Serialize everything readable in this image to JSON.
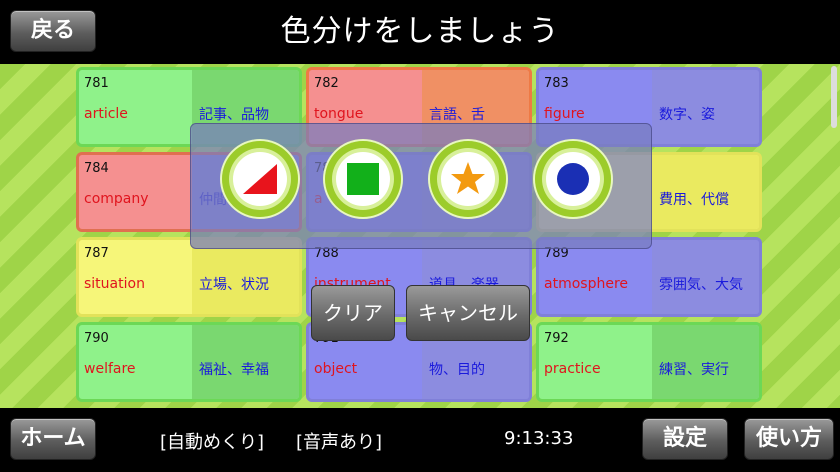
{
  "header": {
    "title": "色分けをしましょう",
    "back_label": "戻る"
  },
  "cards": [
    {
      "num": "781",
      "en": "article",
      "ja": "記事、品物",
      "color": "green"
    },
    {
      "num": "782",
      "en": "tongue",
      "ja": "言語、舌",
      "color": "red"
    },
    {
      "num": "783",
      "en": "figure",
      "ja": "数字、姿",
      "color": "blue"
    },
    {
      "num": "784",
      "en": "company",
      "ja": "仲間",
      "color": "redfull"
    },
    {
      "num": "785",
      "en": "a",
      "ja": "",
      "color": "blue"
    },
    {
      "num": "786",
      "en": "",
      "ja": "費用、代償",
      "color": "yellow"
    },
    {
      "num": "787",
      "en": "situation",
      "ja": "立場、状況",
      "color": "yellow"
    },
    {
      "num": "788",
      "en": "instrument",
      "ja": "道具、楽器",
      "color": "blue"
    },
    {
      "num": "789",
      "en": "atmosphere",
      "ja": "雰囲気、大気",
      "color": "blue"
    },
    {
      "num": "790",
      "en": "welfare",
      "ja": "福祉、幸福",
      "color": "green"
    },
    {
      "num": "791",
      "en": "object",
      "ja": "物、目的",
      "color": "blue"
    },
    {
      "num": "792",
      "en": "practice",
      "ja": "練習、実行",
      "color": "green"
    }
  ],
  "palette": {
    "shapes": [
      "triangle-icon",
      "square-icon",
      "star-icon",
      "circle-icon"
    ],
    "colors": {
      "triangle": "#e8141c",
      "square": "#12b01a",
      "star": "#f39a10",
      "circle": "#1a2fb4"
    }
  },
  "popup": {
    "clear_label": "クリア",
    "cancel_label": "キャンセル"
  },
  "footer": {
    "home_label": "ホーム",
    "auto_flip": "[自動めくり]",
    "audio": "[音声あり]",
    "clock": "9:13:33",
    "settings_label": "設定",
    "howto_label": "使い方"
  }
}
